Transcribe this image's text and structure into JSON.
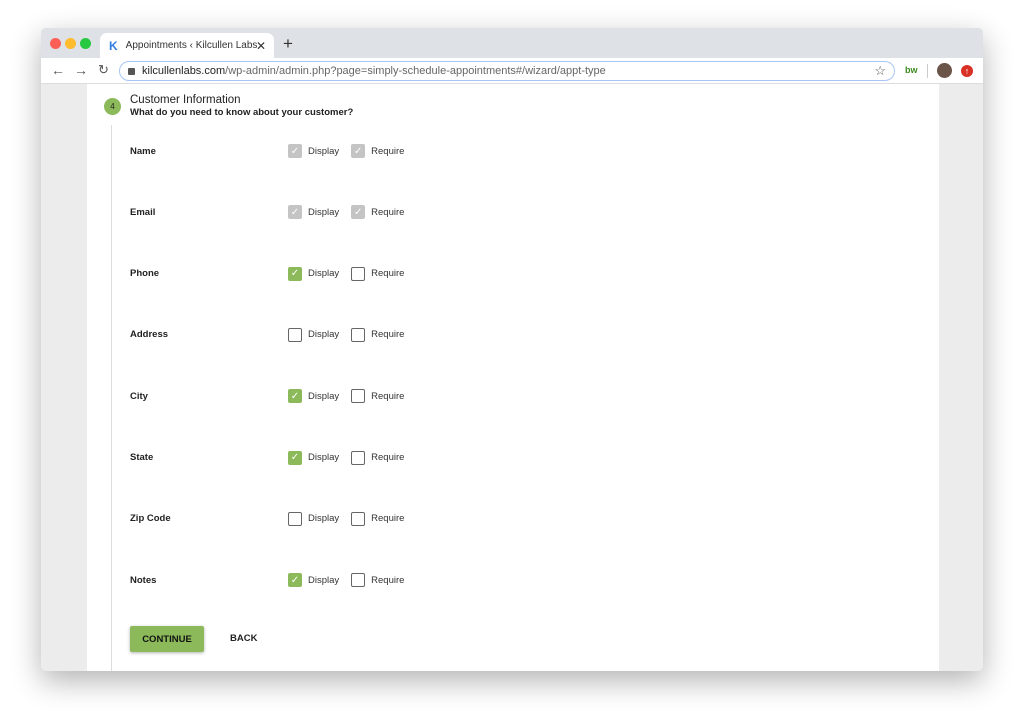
{
  "browser": {
    "tab_title": "Appointments ‹ Kilcullen Labs",
    "tab_favicon": "K",
    "url_host": "kilcullenlabs.com",
    "url_path": "/wp-admin/admin.php?page=simply-schedule-appointments#/wizard/appt-type",
    "extension_label": "bw"
  },
  "step": {
    "number": "4",
    "title": "Customer Information",
    "subtitle": "What do you need to know about your customer?"
  },
  "options": {
    "display": "Display",
    "require": "Require"
  },
  "fields": [
    {
      "label": "Name",
      "display": true,
      "require": true,
      "disabled": true
    },
    {
      "label": "Email",
      "display": true,
      "require": true,
      "disabled": true
    },
    {
      "label": "Phone",
      "display": true,
      "require": false
    },
    {
      "label": "Address",
      "display": false,
      "require": false
    },
    {
      "label": "City",
      "display": true,
      "require": false
    },
    {
      "label": "State",
      "display": true,
      "require": false
    },
    {
      "label": "Zip Code",
      "display": false,
      "require": false
    },
    {
      "label": "Notes",
      "display": true,
      "require": false
    }
  ],
  "buttons": {
    "continue": "CONTINUE",
    "back": "BACK"
  },
  "colors": {
    "accent": "#8cba5a"
  }
}
